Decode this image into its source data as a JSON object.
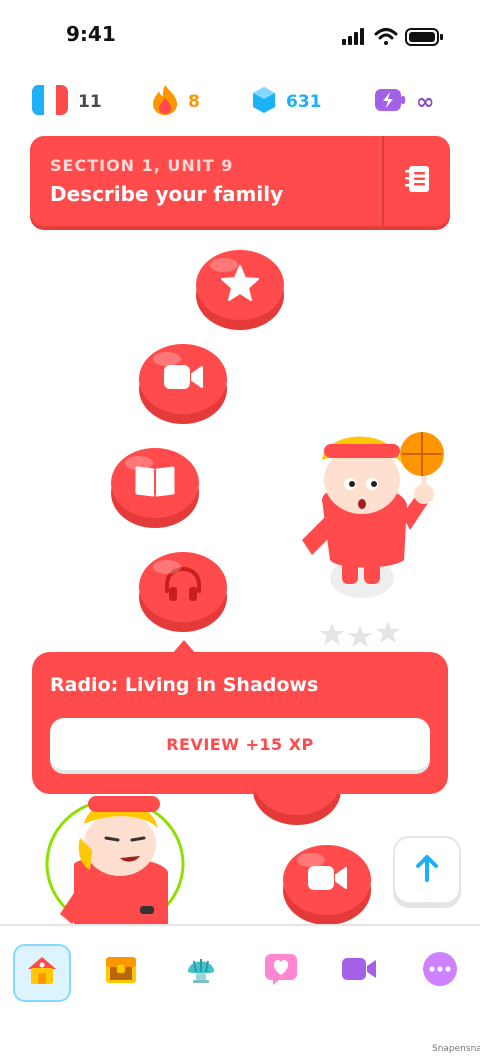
{
  "status_bar": {
    "time": "9:41"
  },
  "stats": {
    "language_count": "11",
    "streak": "8",
    "gems": "631",
    "energy": "∞",
    "colors": {
      "streak": "#ff9600",
      "gems": "#1cb0f6",
      "energy": "#8549ba"
    }
  },
  "unit": {
    "section": "SECTION 1, UNIT 9",
    "title": "Describe your family"
  },
  "path_nodes": [
    {
      "icon": "star-icon"
    },
    {
      "icon": "video-icon"
    },
    {
      "icon": "book-icon"
    },
    {
      "icon": "headphones-icon"
    },
    {
      "icon": "video-icon"
    }
  ],
  "popup": {
    "title": "Radio: Living in Shadows",
    "button_label": "REVIEW +15 XP"
  },
  "bottom_nav": [
    {
      "icon": "home-icon"
    },
    {
      "icon": "treasure-chest-icon"
    },
    {
      "icon": "shell-icon"
    },
    {
      "icon": "heart-icon"
    },
    {
      "icon": "video-camera-icon"
    },
    {
      "icon": "more-icon"
    }
  ],
  "accent_color": "#ff4b4b",
  "watermark": "Snapensnap"
}
